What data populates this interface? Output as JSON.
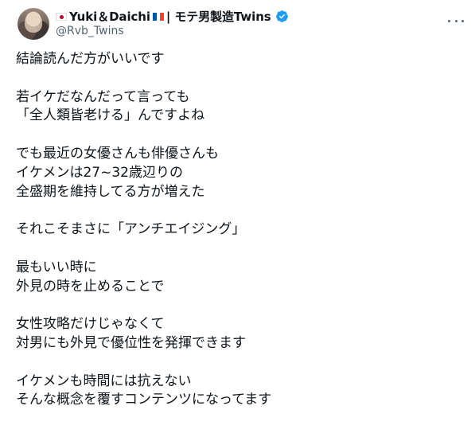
{
  "author": {
    "name_prefix_flag": "jp-flag",
    "display_name": "Yuki＆Daichi",
    "name_suffix_flag": "fr-flag",
    "name_tail": "| モテ男製造Twins",
    "handle": "@Rvb_Twins",
    "verified": true,
    "verified_color": "#1d9bf0"
  },
  "tweet": {
    "paragraphs": [
      [
        "結論読んだ方がいいです"
      ],
      [
        "若イケだなんだって言っても",
        "「全人類皆老ける」んですよね"
      ],
      [
        "でも最近の女優さんも俳優さんも",
        "イケメンは27~32歳辺りの",
        "全盛期を維持してる方が増えた"
      ],
      [
        "それこそまさに「アンチエイジング」"
      ],
      [
        "最もいい時に",
        "外見の時を止めることで"
      ],
      [
        "女性攻略だけじゃなくて",
        "対男にも外見で優位性を発揮できます"
      ],
      [
        "イケメンも時間には抗えない",
        "そんな概念を覆すコンテンツになってます"
      ]
    ]
  },
  "colors": {
    "text": "#0f1419",
    "secondary": "#536471",
    "accent": "#1d9bf0"
  }
}
